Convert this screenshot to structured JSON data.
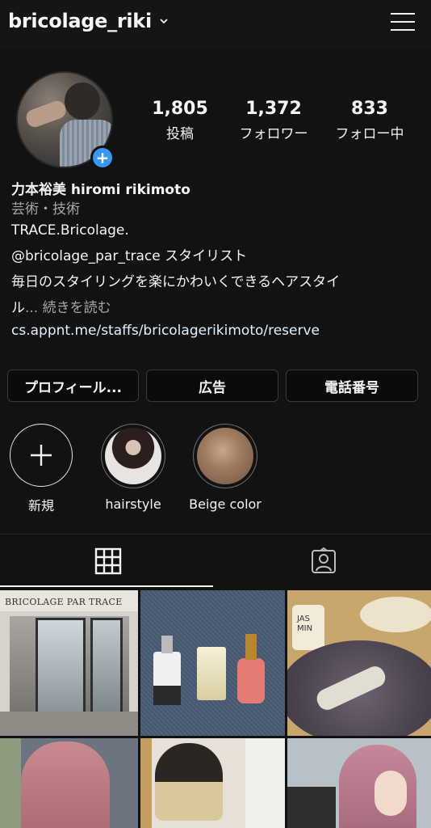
{
  "header": {
    "username": "bricolage_riki"
  },
  "stats": [
    {
      "number": "1,805",
      "label": "投稿"
    },
    {
      "number": "1,372",
      "label": "フォロワー"
    },
    {
      "number": "833",
      "label": "フォロー中"
    }
  ],
  "bio": {
    "name": "力本裕美  hiromi rikimoto",
    "category": "芸術・技術",
    "line1": "TRACE.Bricolage.",
    "mention": "@bricolage_par_trace",
    "mention_suffix": " スタイリスト",
    "line3": "毎日のスタイリングを楽にかわいくできるヘアスタイ",
    "line4_start": "ル",
    "line4_more": "... 続きを読む",
    "link": "cs.appnt.me/staffs/bricolagerikimoto/reserve"
  },
  "buttons": {
    "profile": "プロフィール...",
    "ads": "広告",
    "phone": "電話番号"
  },
  "highlights": [
    {
      "label": "新規"
    },
    {
      "label": "hairstyle"
    },
    {
      "label": "Beige color"
    }
  ],
  "grid": {
    "post1_sign": "BRICOLAGE PAR TRACE",
    "post3_label": "JAS\nMIN"
  },
  "colors": {
    "background": "#121212",
    "accent_blue": "#3897f0",
    "link": "#e0f1ff"
  }
}
